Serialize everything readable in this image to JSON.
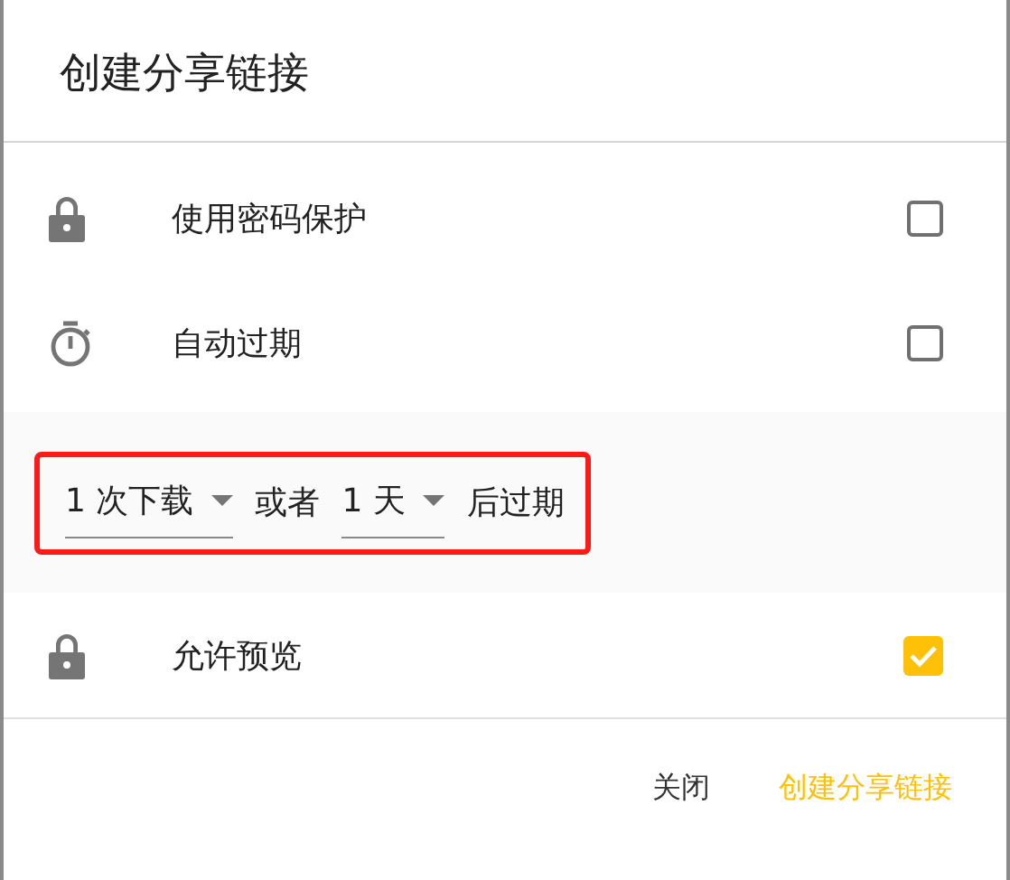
{
  "dialog": {
    "title": "创建分享链接"
  },
  "options": [
    {
      "kind": "checkbox",
      "label": "使用密码保护",
      "checked": false
    },
    {
      "kind": "checkbox",
      "label": "自动过期",
      "checked": false
    },
    {
      "kind": "expiry",
      "highlighted": true,
      "parts": [
        {
          "kind": "dropdown",
          "value": "1 次下载"
        },
        {
          "kind": "text",
          "text": "或者"
        },
        {
          "kind": "dropdown",
          "value": "1 天"
        },
        {
          "kind": "text",
          "text": "后过期"
        }
      ]
    },
    {
      "kind": "checkbox",
      "label": "允许预览",
      "checked": true
    }
  ],
  "buttons": [
    {
      "label": "关闭",
      "primary": false
    },
    {
      "label": "创建分享链接",
      "primary": true
    }
  ]
}
